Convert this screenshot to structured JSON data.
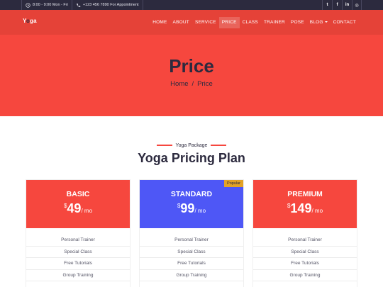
{
  "topbar": {
    "hours": "8:00 - 9:00 Mon - Fri",
    "phone": "+123 456 7890 For Appointment",
    "social": [
      {
        "icon": "twitter-icon",
        "glyph": "t"
      },
      {
        "icon": "facebook-icon",
        "glyph": "f"
      },
      {
        "icon": "linkedin-icon",
        "glyph": "in"
      },
      {
        "icon": "instagram-icon",
        "glyph": "◎"
      }
    ]
  },
  "nav": {
    "logo_pre": "Y",
    "logo_accent": "o",
    "logo_post": "ga",
    "items": [
      "HOME",
      "ABOUT",
      "SERVICE",
      "PRICE",
      "CLASS",
      "TRAINER",
      "POSE",
      "BLOG",
      "CONTACT"
    ],
    "active": "PRICE"
  },
  "hero": {
    "title": "Price",
    "breadcrumb_home": "Home",
    "breadcrumb_sep": "/",
    "breadcrumb_current": "Price"
  },
  "section": {
    "subtitle": "Yoga Package",
    "title": "Yoga Pricing Plan"
  },
  "plans": [
    {
      "name": "BASIC",
      "currency": "$",
      "price": "49",
      "period": "/ mo",
      "color": "#f6473e",
      "badge": "",
      "features": [
        "Personal Trainer",
        "Special Class",
        "Free Tutorials",
        "Group Training"
      ]
    },
    {
      "name": "STANDARD",
      "currency": "$",
      "price": "99",
      "period": "/ mo",
      "color": "#4e57f6",
      "badge": "Popular",
      "features": [
        "Personal Trainer",
        "Special Class",
        "Free Tutorials",
        "Group Training"
      ]
    },
    {
      "name": "PREMIUM",
      "currency": "$",
      "price": "149",
      "period": "/ mo",
      "color": "#f6473e",
      "badge": "",
      "features": [
        "Personal Trainer",
        "Special Class",
        "Free Tutorials",
        "Group Training"
      ]
    }
  ],
  "colors": {
    "accent": "#f6473e",
    "dark": "#2c2a3e",
    "standard": "#4e57f6",
    "badge": "#e3a225"
  }
}
